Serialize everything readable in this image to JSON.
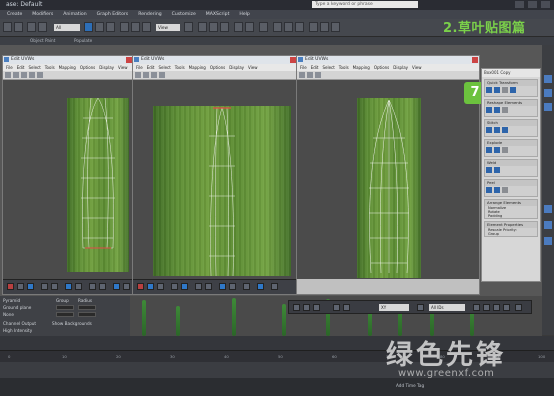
{
  "titlebar": {
    "title": "ase: Default",
    "search_placeholder": "Type a keyword or phrase"
  },
  "menus": [
    "Create",
    "Modifiers",
    "Animation",
    "Graph Editors",
    "Rendering",
    "Customize",
    "MAXScript",
    "Help"
  ],
  "toolbar": {
    "selection_filter": "All",
    "view_dropdown": "View"
  },
  "toolbar2": {
    "object_paint": "Object Paint",
    "populate": "Populate"
  },
  "overlay_title": "2.草叶贴图篇",
  "windows": [
    {
      "title": "Edit UVWs",
      "menus": [
        "File",
        "Edit",
        "Select",
        "Tools",
        "Mapping",
        "Options",
        "Display",
        "View"
      ]
    },
    {
      "title": "Edit UVWs",
      "menus": [
        "File",
        "Edit",
        "Select",
        "Tools",
        "Mapping",
        "Options",
        "Display",
        "View"
      ]
    },
    {
      "title": "Edit UVWs",
      "menus": [
        "File",
        "Edit",
        "Select",
        "Tools",
        "Mapping",
        "Options",
        "Display",
        "View"
      ]
    }
  ],
  "circle_button": "7",
  "cmdpanel": {
    "object_name": "Box001 Copy",
    "rollouts": [
      "Quick Transform",
      "Reshape Elements",
      "Stitch",
      "Explode",
      "Weld",
      "Peel",
      "Arrange Elements",
      "Element Properties"
    ],
    "peel_options": [
      "Normalize",
      "Rotate",
      "Padding"
    ],
    "rescale_priority": "Rescale Priority:",
    "group": "Group"
  },
  "lowerpanel": {
    "labels": [
      "Pyramid",
      "Ground plane",
      "None",
      "Channel Output",
      "High Intensity"
    ],
    "group_label": "Group",
    "radius_label": "Radius",
    "show_backgrounds": "Show Backgrounds"
  },
  "floater": {
    "dropdown": "All IDs",
    "xyz_dropdown": "XY"
  },
  "ruler": {
    "ticks": [
      "0",
      "10",
      "20",
      "30",
      "40",
      "50",
      "60",
      "70",
      "80",
      "90",
      "100"
    ]
  },
  "statusbar": {
    "text": "Add Time Tag"
  },
  "watermark": {
    "cn": "绿色先锋",
    "url": "www.greenxf.com"
  }
}
